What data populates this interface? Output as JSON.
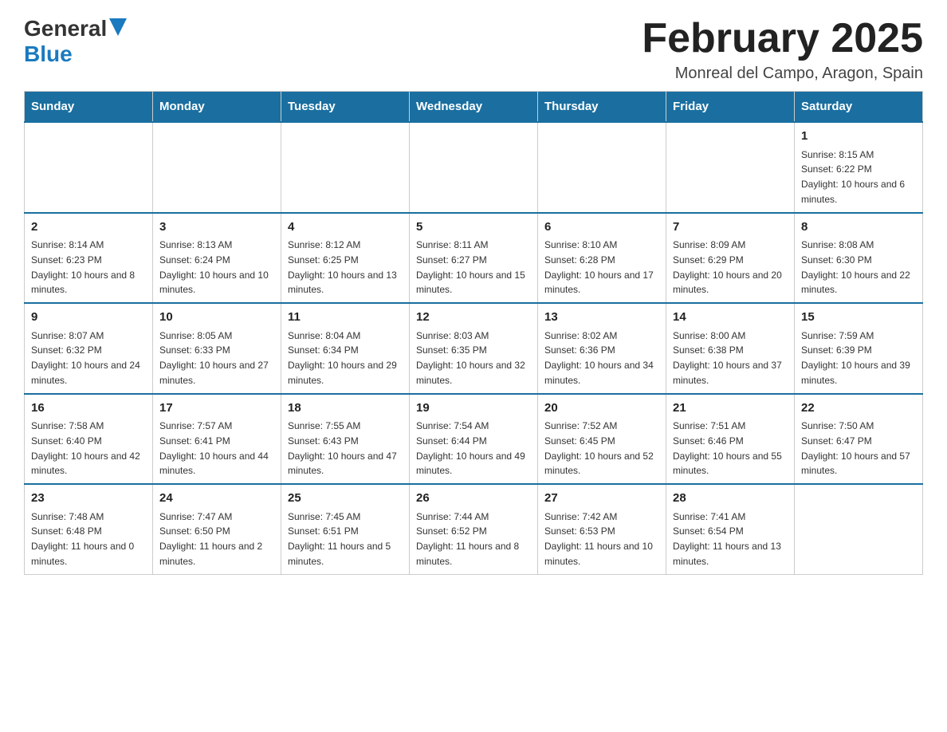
{
  "header": {
    "title": "February 2025",
    "subtitle": "Monreal del Campo, Aragon, Spain",
    "logo_general": "General",
    "logo_blue": "Blue"
  },
  "weekdays": [
    "Sunday",
    "Monday",
    "Tuesday",
    "Wednesday",
    "Thursday",
    "Friday",
    "Saturday"
  ],
  "weeks": [
    [
      {
        "day": "",
        "info": ""
      },
      {
        "day": "",
        "info": ""
      },
      {
        "day": "",
        "info": ""
      },
      {
        "day": "",
        "info": ""
      },
      {
        "day": "",
        "info": ""
      },
      {
        "day": "",
        "info": ""
      },
      {
        "day": "1",
        "info": "Sunrise: 8:15 AM\nSunset: 6:22 PM\nDaylight: 10 hours and 6 minutes."
      }
    ],
    [
      {
        "day": "2",
        "info": "Sunrise: 8:14 AM\nSunset: 6:23 PM\nDaylight: 10 hours and 8 minutes."
      },
      {
        "day": "3",
        "info": "Sunrise: 8:13 AM\nSunset: 6:24 PM\nDaylight: 10 hours and 10 minutes."
      },
      {
        "day": "4",
        "info": "Sunrise: 8:12 AM\nSunset: 6:25 PM\nDaylight: 10 hours and 13 minutes."
      },
      {
        "day": "5",
        "info": "Sunrise: 8:11 AM\nSunset: 6:27 PM\nDaylight: 10 hours and 15 minutes."
      },
      {
        "day": "6",
        "info": "Sunrise: 8:10 AM\nSunset: 6:28 PM\nDaylight: 10 hours and 17 minutes."
      },
      {
        "day": "7",
        "info": "Sunrise: 8:09 AM\nSunset: 6:29 PM\nDaylight: 10 hours and 20 minutes."
      },
      {
        "day": "8",
        "info": "Sunrise: 8:08 AM\nSunset: 6:30 PM\nDaylight: 10 hours and 22 minutes."
      }
    ],
    [
      {
        "day": "9",
        "info": "Sunrise: 8:07 AM\nSunset: 6:32 PM\nDaylight: 10 hours and 24 minutes."
      },
      {
        "day": "10",
        "info": "Sunrise: 8:05 AM\nSunset: 6:33 PM\nDaylight: 10 hours and 27 minutes."
      },
      {
        "day": "11",
        "info": "Sunrise: 8:04 AM\nSunset: 6:34 PM\nDaylight: 10 hours and 29 minutes."
      },
      {
        "day": "12",
        "info": "Sunrise: 8:03 AM\nSunset: 6:35 PM\nDaylight: 10 hours and 32 minutes."
      },
      {
        "day": "13",
        "info": "Sunrise: 8:02 AM\nSunset: 6:36 PM\nDaylight: 10 hours and 34 minutes."
      },
      {
        "day": "14",
        "info": "Sunrise: 8:00 AM\nSunset: 6:38 PM\nDaylight: 10 hours and 37 minutes."
      },
      {
        "day": "15",
        "info": "Sunrise: 7:59 AM\nSunset: 6:39 PM\nDaylight: 10 hours and 39 minutes."
      }
    ],
    [
      {
        "day": "16",
        "info": "Sunrise: 7:58 AM\nSunset: 6:40 PM\nDaylight: 10 hours and 42 minutes."
      },
      {
        "day": "17",
        "info": "Sunrise: 7:57 AM\nSunset: 6:41 PM\nDaylight: 10 hours and 44 minutes."
      },
      {
        "day": "18",
        "info": "Sunrise: 7:55 AM\nSunset: 6:43 PM\nDaylight: 10 hours and 47 minutes."
      },
      {
        "day": "19",
        "info": "Sunrise: 7:54 AM\nSunset: 6:44 PM\nDaylight: 10 hours and 49 minutes."
      },
      {
        "day": "20",
        "info": "Sunrise: 7:52 AM\nSunset: 6:45 PM\nDaylight: 10 hours and 52 minutes."
      },
      {
        "day": "21",
        "info": "Sunrise: 7:51 AM\nSunset: 6:46 PM\nDaylight: 10 hours and 55 minutes."
      },
      {
        "day": "22",
        "info": "Sunrise: 7:50 AM\nSunset: 6:47 PM\nDaylight: 10 hours and 57 minutes."
      }
    ],
    [
      {
        "day": "23",
        "info": "Sunrise: 7:48 AM\nSunset: 6:48 PM\nDaylight: 11 hours and 0 minutes."
      },
      {
        "day": "24",
        "info": "Sunrise: 7:47 AM\nSunset: 6:50 PM\nDaylight: 11 hours and 2 minutes."
      },
      {
        "day": "25",
        "info": "Sunrise: 7:45 AM\nSunset: 6:51 PM\nDaylight: 11 hours and 5 minutes."
      },
      {
        "day": "26",
        "info": "Sunrise: 7:44 AM\nSunset: 6:52 PM\nDaylight: 11 hours and 8 minutes."
      },
      {
        "day": "27",
        "info": "Sunrise: 7:42 AM\nSunset: 6:53 PM\nDaylight: 11 hours and 10 minutes."
      },
      {
        "day": "28",
        "info": "Sunrise: 7:41 AM\nSunset: 6:54 PM\nDaylight: 11 hours and 13 minutes."
      },
      {
        "day": "",
        "info": ""
      }
    ]
  ]
}
